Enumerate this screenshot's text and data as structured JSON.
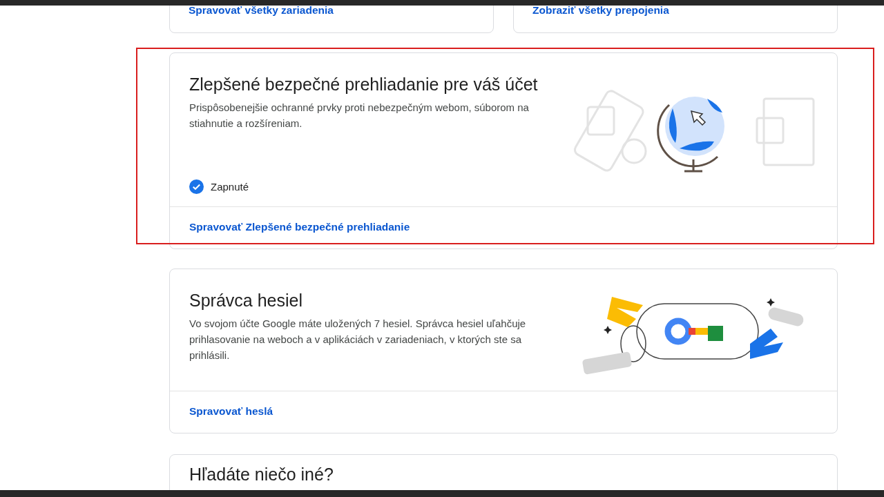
{
  "top_cards": [
    {
      "link": "Spravovať všetky zariadenia"
    },
    {
      "link": "Zobraziť všetky prepojenia"
    }
  ],
  "cards": [
    {
      "kind": "safe_browsing",
      "title": "Zlepšené bezpečné prehliadanie pre váš účet",
      "description": "Prispôsobenejšie ochranné prvky proti nebezpečným webom, súborom na stiahnutie a rozšíreniam.",
      "status": {
        "label": "Zapnuté",
        "on": true
      },
      "link": "Spravovať Zlepšené bezpečné prehliadanie",
      "highlighted": true
    },
    {
      "kind": "passwords",
      "title": "Správca hesiel",
      "description": "Vo svojom účte Google máte uložených 7 hesiel. Správca hesiel uľahčuje prihlasovanie na weboch a v aplikáciách v zariadeniach, v ktorých ste sa prihlásili.",
      "link": "Spravovať heslá",
      "highlighted": false
    }
  ],
  "bottom_card": {
    "title": "Hľadáte niečo iné?"
  }
}
